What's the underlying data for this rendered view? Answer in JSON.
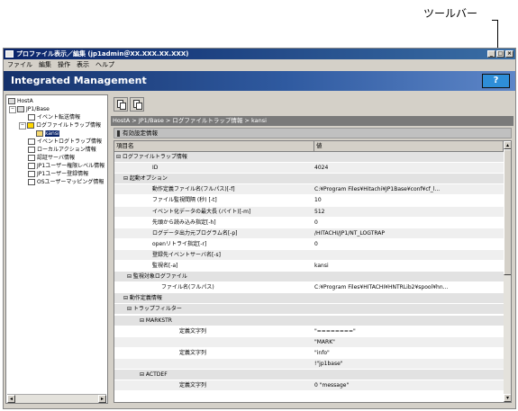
{
  "annotation": {
    "label": "ツールバー"
  },
  "window": {
    "title": "プロファイル表示／編集 (jp1admin＠XX.XXX.XX.XXX)",
    "controls": [
      "_",
      "□",
      "×"
    ]
  },
  "menu": [
    "ファイル",
    "編集",
    "操作",
    "表示",
    "ヘルプ"
  ],
  "banner": {
    "title": "Integrated Management",
    "help_label": "?"
  },
  "tree": {
    "items": [
      {
        "label": "HostA",
        "indent": 0
      },
      {
        "label": "JP1/Base",
        "indent": 1
      },
      {
        "label": "イベント転送情報",
        "indent": 2
      },
      {
        "label": "ログファイルトラップ情報",
        "indent": 2
      },
      {
        "label": "kansi",
        "indent": 3,
        "selected": true
      },
      {
        "label": "イベントログトラップ情報",
        "indent": 2
      },
      {
        "label": "ローカルアクション情報",
        "indent": 2
      },
      {
        "label": "認証サーバ情報",
        "indent": 2
      },
      {
        "label": "JP1ユーザー権限レベル情報",
        "indent": 2
      },
      {
        "label": "JP1ユーザー登録情報",
        "indent": 2
      },
      {
        "label": "OSユーザーマッピング情報",
        "indent": 2
      }
    ]
  },
  "breadcrumb": "HostA > JP1/Base > ログファイルトラップ情報 > kansi",
  "section_header": "有効設定情報",
  "table": {
    "col_name": "項目名",
    "col_value": "値",
    "rows": [
      {
        "name": "⊟ ログファイルトラップ情報",
        "value": "",
        "level": 0,
        "group": true
      },
      {
        "name": "ID",
        "value": "4024",
        "level": 2
      },
      {
        "name": "⊟ 起動オプション",
        "value": "",
        "level": 1,
        "group": true
      },
      {
        "name": "動作定義ファイル名(フルパス)[-f]",
        "value": "C:¥Program Files¥Hitachi¥JP1Base¥conf¥cf_l...",
        "level": 2
      },
      {
        "name": "ファイル監視間隔 (秒) [-t]",
        "value": "10",
        "level": 2
      },
      {
        "name": "イベント化データの最大長 (バイト)[-m]",
        "value": "512",
        "level": 2
      },
      {
        "name": "先頭から読み込み指定[-h]",
        "value": "0",
        "level": 2
      },
      {
        "name": "ログデータ出力元プログラム名[-p]",
        "value": "/HITACHI/JP1/NT_LOGTRAP",
        "level": 2
      },
      {
        "name": "openリトライ指定[-r]",
        "value": "0",
        "level": 2
      },
      {
        "name": "登録先イベントサーバ名[-s]",
        "value": "",
        "level": 2
      },
      {
        "name": "監視名[-a]",
        "value": "kansi",
        "level": 2
      },
      {
        "name": "⊟ 監視対象ログファイル",
        "value": "",
        "level": 2,
        "group": true
      },
      {
        "name": "ファイル名(フルパス)",
        "value": "C:¥Program Files¥HITACHI¥HNTRLib2¥spool¥hn...",
        "level": 3
      },
      {
        "name": "⊟ 動作定義情報",
        "value": "",
        "level": 1,
        "group": true
      },
      {
        "name": "⊟ トラップフィルター",
        "value": "",
        "level": 2,
        "group": true
      },
      {
        "name": "⊟ MARKSTR",
        "value": "",
        "level": 3,
        "group": true
      },
      {
        "name": "定義文字列",
        "value": "\"========\"",
        "level": 4
      },
      {
        "name": "",
        "value": "\"MARK\"",
        "level": 4
      },
      {
        "name": "定義文字列",
        "value": "\"info\"",
        "level": 4
      },
      {
        "name": "",
        "value": "!\"jp1base\"",
        "level": 4
      },
      {
        "name": "⊟ ACTDEF",
        "value": "",
        "level": 3,
        "group": true
      },
      {
        "name": "定義文字列",
        "value": "0        \"message\"",
        "level": 4
      }
    ]
  }
}
